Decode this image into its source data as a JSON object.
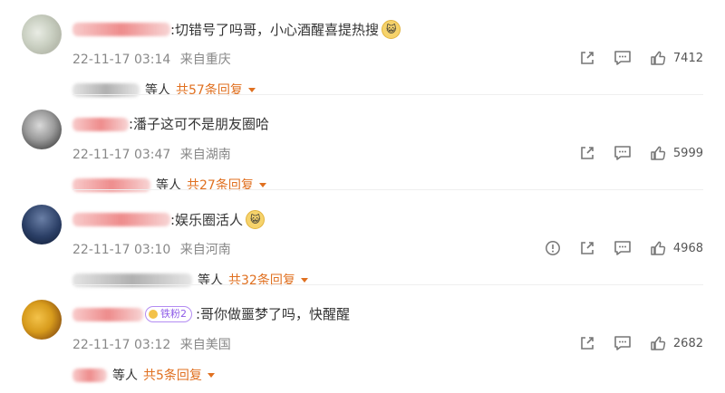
{
  "comments": [
    {
      "text": ":切错号了吗哥，小心酒醒喜提热搜",
      "emoji": "😺",
      "timestamp": "22-11-17 03:14",
      "location": "来自重庆",
      "likes": "7412",
      "replies_suffix": "等人",
      "replies_more": "共57条回复"
    },
    {
      "text": ":潘子这可不是朋友圈哈",
      "emoji": "",
      "timestamp": "22-11-17 03:47",
      "location": "来自湖南",
      "likes": "5999",
      "replies_suffix": "等人",
      "replies_more": "共27条回复"
    },
    {
      "text": ":娱乐圈活人",
      "emoji": "😺",
      "timestamp": "22-11-17 03:10",
      "location": "来自河南",
      "likes": "4968",
      "replies_suffix": "等人",
      "replies_more": "共32条回复"
    },
    {
      "badge": "铁粉2",
      "text": ":哥你做噩梦了吗，快醒醒",
      "emoji": "",
      "timestamp": "22-11-17 03:12",
      "location": "来自美国",
      "likes": "2682",
      "replies_suffix": "等人",
      "replies_more": "共5条回复"
    }
  ],
  "icons": {
    "share": "share-icon",
    "comment": "comment-icon",
    "like": "thumbs-up-icon",
    "report": "report-icon",
    "expand": "chevron-down-icon"
  },
  "colors": {
    "accent": "#e07020",
    "meta": "#888888",
    "badge": "#8e5ce8"
  }
}
